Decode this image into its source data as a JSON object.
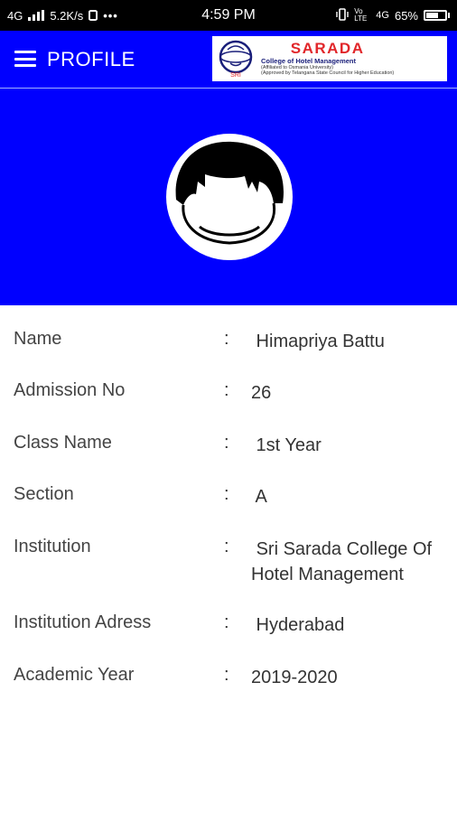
{
  "status_bar": {
    "network": "4G",
    "speed": "5.2K/s",
    "more": "•••",
    "time": "4:59 PM",
    "volte": "Vo LTE",
    "network_right": "4G",
    "battery_percent": "65%",
    "battery_level": 0.65
  },
  "header": {
    "menu_icon": "hamburger-menu-icon",
    "title": "PROFILE",
    "logo": {
      "name": "SARADA",
      "subtitle": "College of Hotel Management",
      "line1": "(Affiliated to Osmania University)",
      "line2": "(Approved by Telangana State Council for Higher Education)",
      "mark_text": "SRI"
    }
  },
  "colors": {
    "primary": "#0000ff",
    "status_bar": "#000000",
    "logo_red": "#e1262a",
    "logo_navy": "#1a1f7a",
    "text": "#333333"
  },
  "profile": {
    "avatar_icon": "user-avatar-icon",
    "fields": [
      {
        "label": "Name",
        "colon": ":",
        "value": " Himapriya Battu"
      },
      {
        "label": "Admission No",
        "colon": ":",
        "value": "26"
      },
      {
        "label": "Class Name",
        "colon": ":",
        "value": " 1st Year"
      },
      {
        "label": "Section",
        "colon": ":",
        "value": " A"
      },
      {
        "label": "Institution",
        "colon": ":",
        "value": " Sri Sarada College Of Hotel Management"
      },
      {
        "label": "Institution Adress",
        "colon": ":",
        "value": " Hyderabad"
      },
      {
        "label": "Academic Year",
        "colon": ":",
        "value": "2019-2020"
      }
    ]
  }
}
